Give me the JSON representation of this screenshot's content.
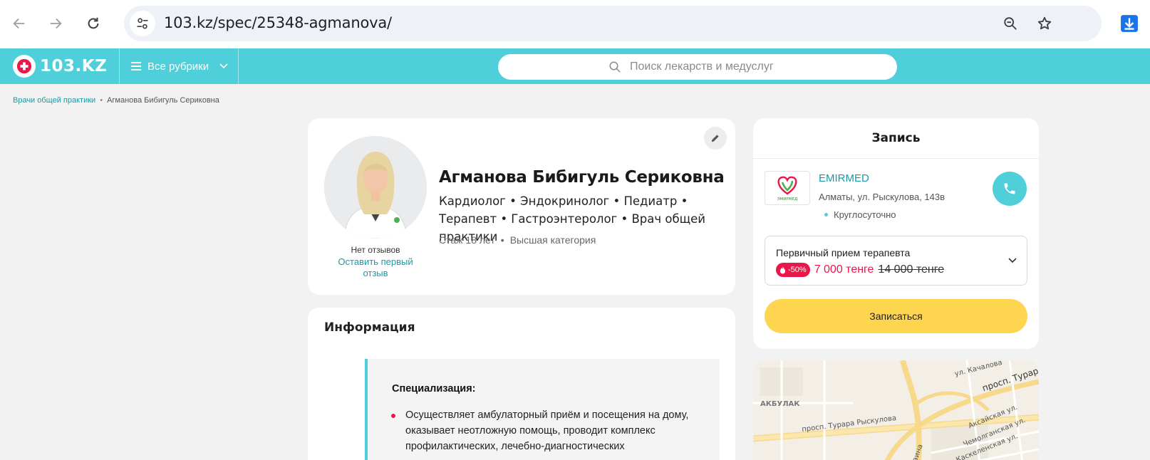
{
  "browser": {
    "url": "103.kz/spec/25348-agmanova/",
    "icons": [
      "back-icon",
      "forward-icon",
      "reload-icon",
      "tune-icon",
      "zoom-icon",
      "star-icon",
      "download-icon"
    ]
  },
  "header": {
    "logo_text": "103.KZ",
    "rubrics_label": "Все рубрики",
    "search_placeholder": "Поиск лекарств и медуслуг",
    "colors": {
      "brand": "#4ecfd9",
      "accent_red": "#e8184b",
      "cta_yellow": "#fdd54f"
    }
  },
  "breadcrumb": {
    "link": "Врачи общей практики",
    "separator": "•",
    "current": "Агманова Бибигуль Сериковна"
  },
  "profile": {
    "name": "Агманова Бибигуль Сериковна",
    "specialties": "Кардиолог • Эндокринолог • Педиатр • Терапевт • Гастроэнтеролог • Врач общей практики",
    "experience": "Стаж 18 лет",
    "meta_separator": "•",
    "category": "Высшая категория",
    "no_reviews": "Нет отзывов",
    "leave_review": "Оставить первый отзыв"
  },
  "info": {
    "title": "Информация",
    "spec_heading": "Специализация:",
    "spec_item": "Осуществляет амбулаторный приём и посещения на дому, оказывает неотложную помощь, проводит комплекс профилактических, лечебно-диагностических"
  },
  "booking": {
    "title": "Запись",
    "clinic_name": "EMIRMED",
    "clinic_address": "Алматы, ул. Рыскулова, 143в",
    "clinic_hours": "Круглосуточно",
    "logo_caption": "ЭМИРМЕД",
    "service_name": "Первичный прием терапевта",
    "discount": "-50%",
    "price_new": "7 000 тенге",
    "price_old": "14 000 тенге",
    "book_button": "Записаться"
  },
  "map": {
    "labels": [
      "ул. Качалова",
      "просп. Турар",
      "АКБУЛАК",
      "просп. Турара Рыскулова",
      "Аксайская ул.",
      "Чемолганская ул.",
      "Каскеленская ул.",
      "Саина"
    ]
  }
}
